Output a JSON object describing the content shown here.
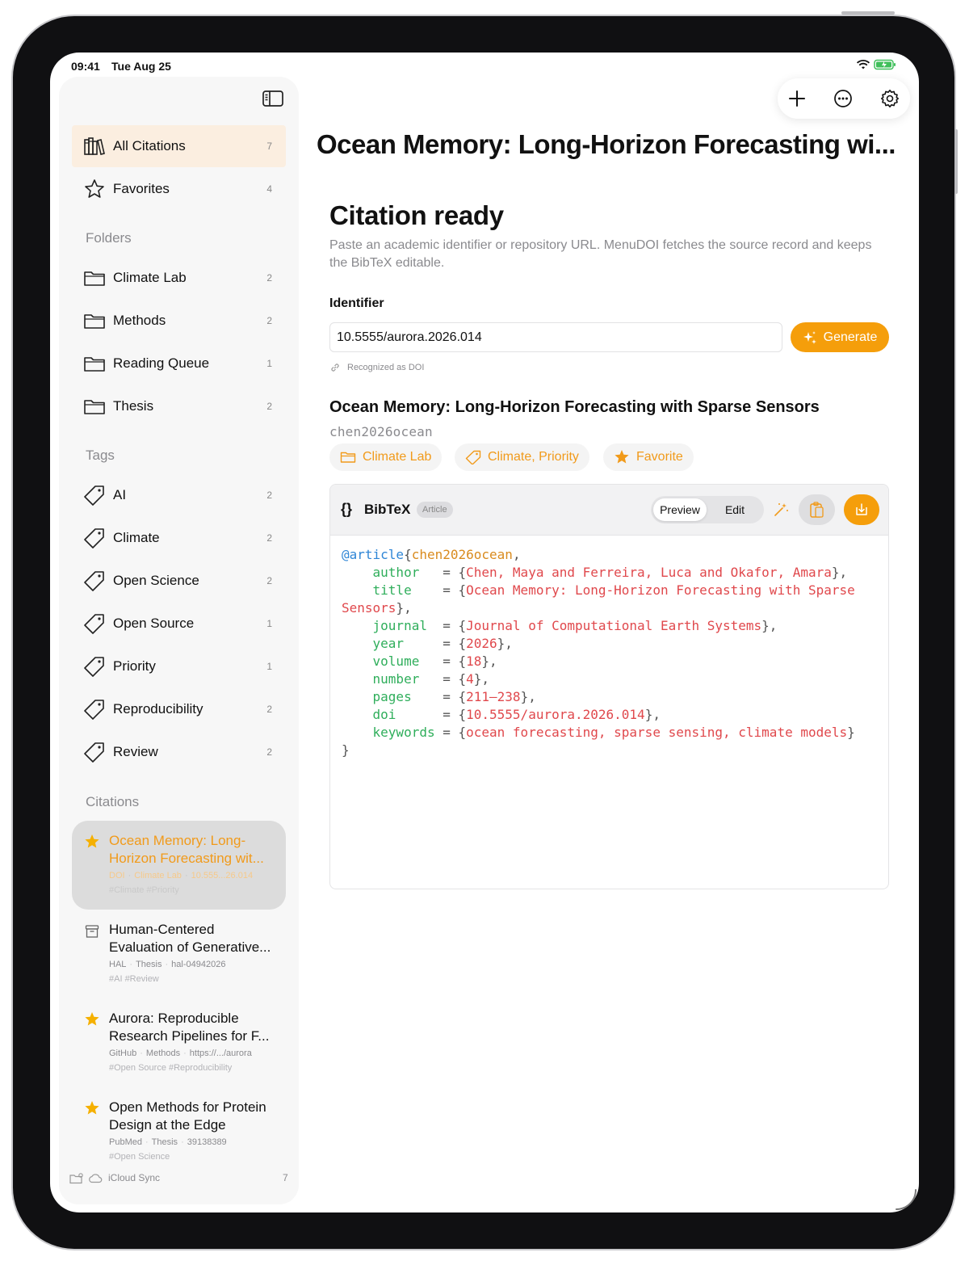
{
  "status_bar": {
    "time": "09:41",
    "date": "Tue Aug 25"
  },
  "sidebar": {
    "library": [
      {
        "label": "All Citations",
        "count": "7",
        "icon": "books-icon",
        "selected": true
      },
      {
        "label": "Favorites",
        "count": "4",
        "icon": "star-outline-icon",
        "selected": false
      }
    ],
    "folders_heading": "Folders",
    "folders": [
      {
        "label": "Climate Lab",
        "count": "2"
      },
      {
        "label": "Methods",
        "count": "2"
      },
      {
        "label": "Reading Queue",
        "count": "1"
      },
      {
        "label": "Thesis",
        "count": "2"
      }
    ],
    "tags_heading": "Tags",
    "tags": [
      {
        "label": "AI",
        "count": "2"
      },
      {
        "label": "Climate",
        "count": "2"
      },
      {
        "label": "Open Science",
        "count": "2"
      },
      {
        "label": "Open Source",
        "count": "1"
      },
      {
        "label": "Priority",
        "count": "1"
      },
      {
        "label": "Reproducibility",
        "count": "2"
      },
      {
        "label": "Review",
        "count": "2"
      }
    ],
    "citations_heading": "Citations",
    "citations": [
      {
        "title": "Ocean Memory: Long-Horizon Forecasting wit...",
        "meta": [
          "DOI",
          "Climate Lab",
          "10.555...26.014"
        ],
        "tags": "#Climate  #Priority",
        "favorite": true,
        "active": true
      },
      {
        "title": "Human-Centered Evaluation of Generative...",
        "meta": [
          "HAL",
          "Thesis",
          "hal-04942026"
        ],
        "tags": "#AI  #Review",
        "favorite": false,
        "active": false
      },
      {
        "title": "Aurora: Reproducible Research Pipelines for F...",
        "meta": [
          "GitHub",
          "Methods",
          "https://.../aurora"
        ],
        "tags": "#Open Source  #Reproducibility",
        "favorite": true,
        "active": false
      },
      {
        "title": "Open Methods for Protein Design at the Edge",
        "meta": [
          "PubMed",
          "Thesis",
          "39138389"
        ],
        "tags": "#Open Science",
        "favorite": true,
        "active": false
      }
    ],
    "footer": {
      "label": "iCloud Sync",
      "count": "7"
    }
  },
  "toolbar": {
    "add": "plus-icon",
    "more": "ellipsis-circle-icon",
    "settings": "gear-icon"
  },
  "main": {
    "doc_title": "Ocean Memory: Long-Horizon Forecasting wi...",
    "heading": "Citation ready",
    "description": "Paste an academic identifier or repository URL. MenuDOI fetches the source record and keeps the BibTeX editable.",
    "identifier_label": "Identifier",
    "identifier_value": "10.5555/aurora.2026.014",
    "generate_label": "Generate",
    "recognized": "Recognized as DOI",
    "citation_title": "Ocean Memory: Long-Horizon Forecasting with Sparse Sensors",
    "citation_key": "chen2026ocean",
    "chips": {
      "folder": "Climate Lab",
      "tags": "Climate, Priority",
      "favorite": "Favorite"
    },
    "bibtex": {
      "label": "BibTeX",
      "badge": "Article",
      "modes": [
        "Preview",
        "Edit"
      ],
      "active_mode": "Preview",
      "entry_type": "@article",
      "cite_key": "chen2026ocean",
      "fields": [
        {
          "name": "author",
          "value": "Chen, Maya and Ferreira, Luca and Okafor, Amara"
        },
        {
          "name": "title",
          "value": "Ocean Memory: Long-Horizon Forecasting with Sparse Sensors"
        },
        {
          "name": "journal",
          "value": "Journal of Computational Earth Systems"
        },
        {
          "name": "year",
          "value": "2026"
        },
        {
          "name": "volume",
          "value": "18"
        },
        {
          "name": "number",
          "value": "4"
        },
        {
          "name": "pages",
          "value": "211–238"
        },
        {
          "name": "doi",
          "value": "10.5555/aurora.2026.014"
        },
        {
          "name": "keywords",
          "value": "ocean forecasting, sparse sensing, climate models"
        }
      ]
    }
  },
  "colors": {
    "accent": "#f59e0b",
    "selected_bg": "#fbeee0",
    "sidebar_bg": "#f7f7f7"
  }
}
